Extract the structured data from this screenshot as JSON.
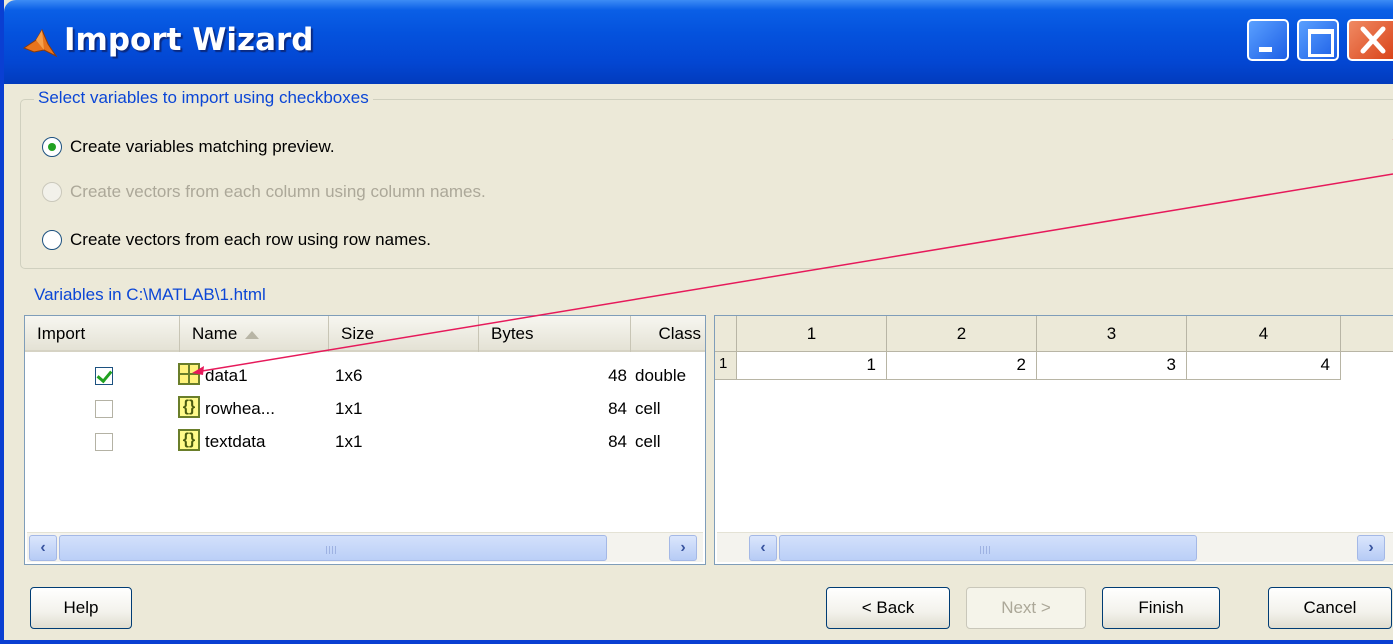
{
  "window": {
    "title": "Import Wizard"
  },
  "options": {
    "legend": "Select variables to import using checkboxes",
    "radio_preview": "Create variables matching preview.",
    "radio_columns": "Create vectors from each column using column names.",
    "radio_rows": "Create vectors from each row using row names.",
    "selected": "radio_preview"
  },
  "variables": {
    "label": "Variables in C:\\MATLAB\\1.html",
    "headers": [
      "Import",
      "Name",
      "Size",
      "Bytes",
      "Class"
    ],
    "sort_column": "Name",
    "rows": [
      {
        "checked": true,
        "icon": "matrix-icon",
        "name": "data1",
        "size": "1x6",
        "bytes": "48",
        "class": "double"
      },
      {
        "checked": false,
        "icon": "cell-icon",
        "name": "rowhea...",
        "size": "1x1",
        "bytes": "84",
        "class": "cell"
      },
      {
        "checked": false,
        "icon": "cell-icon",
        "name": "textdata",
        "size": "1x1",
        "bytes": "84",
        "class": "cell"
      }
    ]
  },
  "preview": {
    "col_headers": [
      "1",
      "2",
      "3",
      "4"
    ],
    "rows": [
      {
        "row_header": "1",
        "values": [
          "1",
          "2",
          "3",
          "4"
        ]
      }
    ]
  },
  "buttons": {
    "help": "Help",
    "back": "< Back",
    "next": "Next >",
    "finish": "Finish",
    "cancel": "Cancel"
  },
  "icons": {
    "scroll_left": "‹",
    "scroll_right": "›"
  },
  "colors": {
    "titlebar": "#0452dd",
    "accent_text": "#0b46d6",
    "annotation_line": "#e6195a"
  }
}
